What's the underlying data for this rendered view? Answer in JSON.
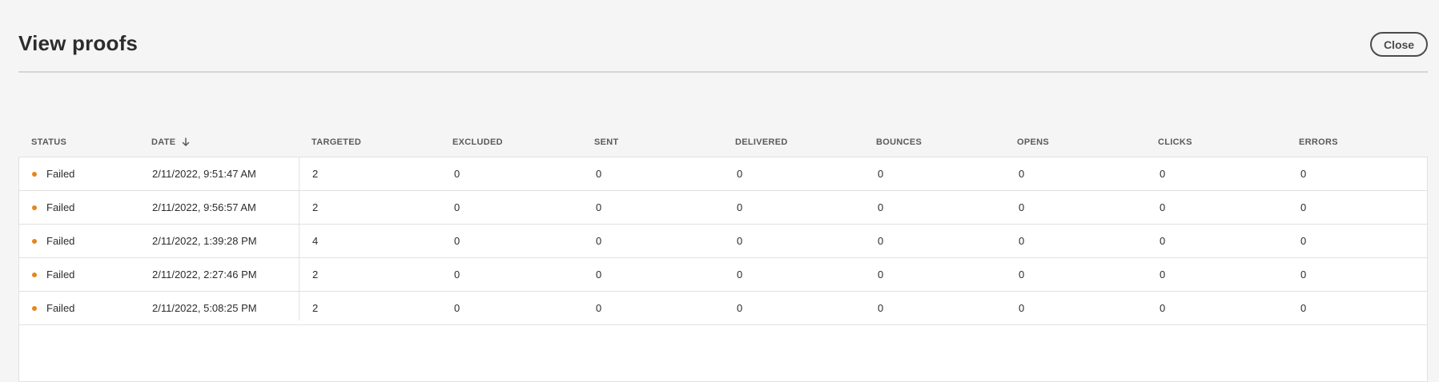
{
  "dialog": {
    "title": "View proofs",
    "close_label": "Close"
  },
  "colors": {
    "status_failed": "#e68619",
    "background": "#f5f5f5"
  },
  "table": {
    "headers": {
      "status": "STATUS",
      "date": "DATE",
      "targeted": "TARGETED",
      "excluded": "EXCLUDED",
      "sent": "SENT",
      "delivered": "DELIVERED",
      "bounces": "BOUNCES",
      "opens": "OPENS",
      "clicks": "CLICKS",
      "errors": "ERRORS"
    },
    "sort": {
      "column": "date",
      "direction": "descending",
      "icon": "arrow-down-icon"
    },
    "rows": [
      {
        "status": "Failed",
        "date": "2/11/2022, 9:51:47 AM",
        "targeted": "2",
        "excluded": "0",
        "sent": "0",
        "delivered": "0",
        "bounces": "0",
        "opens": "0",
        "clicks": "0",
        "errors": "0"
      },
      {
        "status": "Failed",
        "date": "2/11/2022, 9:56:57 AM",
        "targeted": "2",
        "excluded": "0",
        "sent": "0",
        "delivered": "0",
        "bounces": "0",
        "opens": "0",
        "clicks": "0",
        "errors": "0"
      },
      {
        "status": "Failed",
        "date": "2/11/2022, 1:39:28 PM",
        "targeted": "4",
        "excluded": "0",
        "sent": "0",
        "delivered": "0",
        "bounces": "0",
        "opens": "0",
        "clicks": "0",
        "errors": "0"
      },
      {
        "status": "Failed",
        "date": "2/11/2022, 2:27:46 PM",
        "targeted": "2",
        "excluded": "0",
        "sent": "0",
        "delivered": "0",
        "bounces": "0",
        "opens": "0",
        "clicks": "0",
        "errors": "0"
      },
      {
        "status": "Failed",
        "date": "2/11/2022, 5:08:25 PM",
        "targeted": "2",
        "excluded": "0",
        "sent": "0",
        "delivered": "0",
        "bounces": "0",
        "opens": "0",
        "clicks": "0",
        "errors": "0"
      }
    ]
  }
}
